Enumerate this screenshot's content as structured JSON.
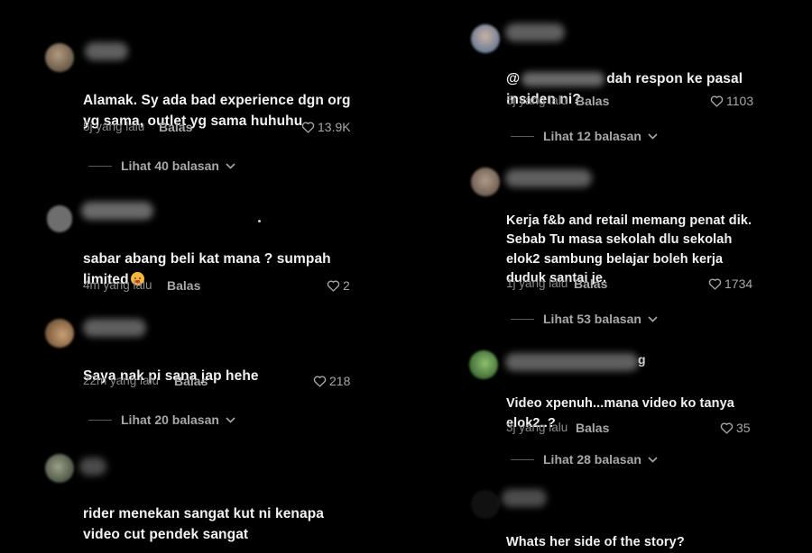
{
  "comments": [
    {
      "text_line1": "Alamak. Sy ada bad experience dgn org",
      "text_line2": "yg sama, outlet yg sama huhuhu",
      "time": "5j yang lalu",
      "reply": "Balas",
      "likes": "13.9K",
      "view_replies": "Lihat 40 balasan"
    },
    {
      "text_line1": "sabar abang beli kat mana ? sumpah",
      "text_line2": "limited",
      "time": "4m yang lalu",
      "reply": "Balas",
      "likes": "2"
    },
    {
      "text_line1": "Saya nak pi sana jap hehe",
      "time": "22m yang lalu",
      "reply": "Balas",
      "likes": "218",
      "view_replies": "Lihat 20 balasan"
    },
    {
      "text_line1": "rider menekan sangat kut ni kenapa",
      "text_line2": "video cut pendek sangat"
    },
    {
      "mention_prefix": "@",
      "text_line1_rest": "dah respon ke pasal",
      "text_line2": "insiden ni?",
      "time": "5j yang lalu",
      "reply": "Balas",
      "likes": "1103",
      "view_replies": "Lihat 12 balasan"
    },
    {
      "text_line1": "Kerja f&b and retail memang penat dik.",
      "text_line2": "Sebab Tu masa sekolah dlu sekolah",
      "text_line3": "elok2 sambung belajar boleh kerja",
      "text_line4": "duduk santai je.",
      "time": "1j yang lalu",
      "reply": "Balas",
      "likes": "1734",
      "view_replies": "Lihat 53 balasan"
    },
    {
      "username_tail": "g",
      "text_line1": "Video xpenuh...mana video ko tanya",
      "text_line2": "elok2..?",
      "time": "3j yang lalu",
      "reply": "Balas",
      "likes": "35",
      "view_replies": "Lihat 28 balasan"
    },
    {
      "text_line1": "Whats her side of the story?"
    }
  ],
  "icons": {
    "like": "heart-outline-icon",
    "expand": "chevron-down-icon"
  },
  "colors": {
    "background": "#000000",
    "text": "#f2f2f2",
    "muted": "#8a8a8a"
  }
}
